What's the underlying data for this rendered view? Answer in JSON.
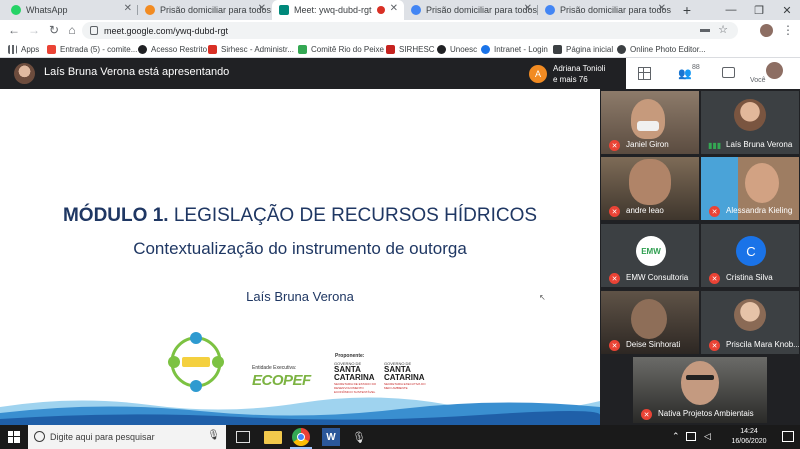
{
  "browser": {
    "tabs": [
      {
        "label": "WhatsApp",
        "favicon_color": "#25d366",
        "active": false
      },
      {
        "label": "Prisão domiciliar para todos os",
        "favicon_color": "#f28b22",
        "active": false
      },
      {
        "label": "Meet: ywq-dubd-rgt",
        "favicon_color": "#00897b",
        "active": true
      },
      {
        "label": "Prisão domiciliar para todos os",
        "favicon_color": "#4285f4",
        "active": false
      },
      {
        "label": "Prisão domiciliar para todos os",
        "favicon_color": "#4285f4",
        "active": false
      }
    ],
    "new_tab": "+",
    "url": "meet.google.com/ywq-dubd-rgt",
    "bookmarks": [
      {
        "label": "Apps",
        "color": "#5f6368"
      },
      {
        "label": "Entrada (5) - comite...",
        "color": "#ea4335"
      },
      {
        "label": "Acesso Restrito",
        "color": "#202124"
      },
      {
        "label": "Sirhesc - Administr...",
        "color": "#d93025"
      },
      {
        "label": "Comitê Rio do Peixe",
        "color": "#34a853"
      },
      {
        "label": "SIRHESC",
        "color": "#c5221f"
      },
      {
        "label": "Unoesc",
        "color": "#202124"
      },
      {
        "label": "Intranet - Login",
        "color": "#1a73e8"
      },
      {
        "label": "Página inicial",
        "color": "#3c4043"
      },
      {
        "label": "Online Photo Editor...",
        "color": "#3c4043"
      }
    ]
  },
  "meet": {
    "presenting_text": "Laís Bruna Verona está apresentando",
    "joined_name": "Adriana Tonioli",
    "joined_more": "e mais 76",
    "joined_initial": "A",
    "participants_count": "88",
    "you_label": "Você"
  },
  "slide": {
    "title_bold": "MÓDULO 1.",
    "title_rest": " LEGISLAÇÃO DE RECURSOS HÍDRICOS",
    "subtitle": "Contextualização do instrumento de outorga",
    "author": "Laís Bruna Verona",
    "logo_executive_label": "Entidade Executiva:",
    "logo_executive_name": "ECOPEF",
    "logo_proponent_label": "Proponente:",
    "logo_sc1_top": "GOVERNO DE",
    "logo_sc1_name": "SANTA CATARINA",
    "logo_sc1_sub": "SECRETARIA DE ESTADO DO DESENVOLVIMENTO ECONÔMICO SUSTENTÁVEL",
    "logo_sc2_top": "GOVERNO DE",
    "logo_sc2_name": "SANTA CATARINA",
    "logo_sc2_sub": "SECRETARIA EXECUTIVA DO MEIO AMBIENTE"
  },
  "participants": [
    {
      "name": "Janiel Giron",
      "muted": true,
      "avatar": "",
      "color": "#8d7b6a"
    },
    {
      "name": "Laís Bruna Verona",
      "muted": false,
      "avatar": "",
      "color": "#c9a58c"
    },
    {
      "name": "andre leao",
      "muted": true,
      "avatar": "",
      "color": "#7e6b57"
    },
    {
      "name": "Alessandra Kieling",
      "muted": true,
      "avatar": "",
      "color": "#9e7d62"
    },
    {
      "name": "EMW Consultoria",
      "muted": true,
      "avatar": "EMW",
      "color": "#2e9e4f"
    },
    {
      "name": "Cristina Silva",
      "muted": true,
      "avatar": "C",
      "color": "#1a73e8"
    },
    {
      "name": "Deise Sinhorati",
      "muted": true,
      "avatar": "",
      "color": "#5f5347"
    },
    {
      "name": "Priscila Mara Knob...",
      "muted": true,
      "avatar": "",
      "color": "#b09a88"
    },
    {
      "name": "Nativa Projetos Ambientais",
      "muted": true,
      "avatar": "",
      "color": "#4a4a48"
    }
  ],
  "taskbar": {
    "search_placeholder": "Digite aqui para pesquisar",
    "time": "14:24",
    "date": "16/06/2020"
  }
}
